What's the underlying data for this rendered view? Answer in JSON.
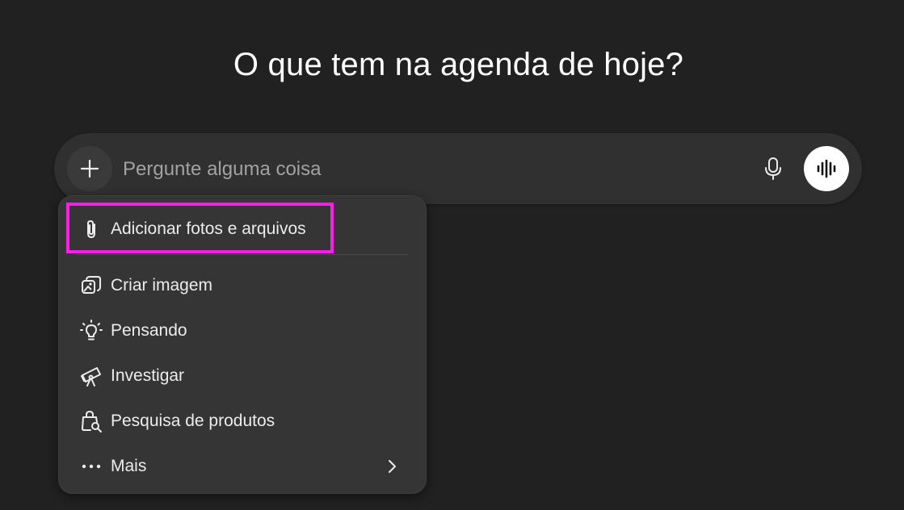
{
  "heading": "O que tem na agenda de hoje?",
  "composer": {
    "placeholder": "Pergunte alguma coisa",
    "plus_icon": "plus-icon",
    "mic_icon": "microphone-icon",
    "voice_icon": "voice-waveform-icon"
  },
  "menu": {
    "items": [
      {
        "label": "Adicionar fotos e arquivos",
        "icon": "paperclip-icon"
      },
      {
        "label": "Criar imagem",
        "icon": "image-create-icon"
      },
      {
        "label": "Pensando",
        "icon": "lightbulb-icon"
      },
      {
        "label": "Investigar",
        "icon": "telescope-icon"
      },
      {
        "label": "Pesquisa de produtos",
        "icon": "shopping-bag-search-icon"
      },
      {
        "label": "Mais",
        "icon": "more-dots-icon",
        "submenu_icon": "chevron-right-icon"
      }
    ]
  },
  "annotation": {
    "highlight_color": "#ff1de7"
  }
}
